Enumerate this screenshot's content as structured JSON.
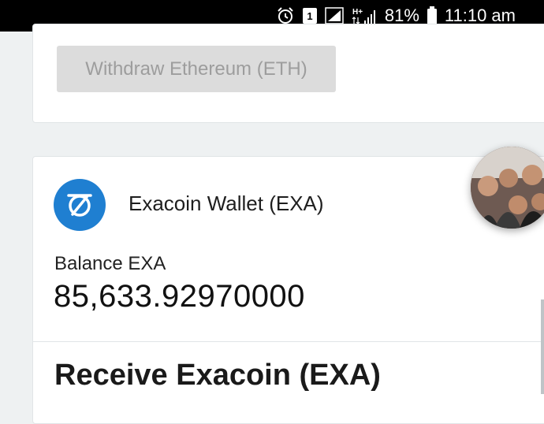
{
  "status_bar": {
    "sim_badge": "1",
    "network_type": "H+",
    "battery_percent": "81%",
    "time": "11:10 am",
    "icons": [
      "alarm-icon",
      "sim-icon",
      "signal-icon",
      "network-icon",
      "battery-icon"
    ]
  },
  "eth_card": {
    "withdraw_label": "Withdraw Ethereum (ETH)"
  },
  "exa_card": {
    "logo_icon": "exacoin-logo-icon",
    "wallet_title": "Exacoin Wallet (EXA)",
    "balance_label": "Balance EXA",
    "balance_value": "85,633.92970000",
    "receive_heading": "Receive Exacoin (EXA)"
  },
  "colors": {
    "accent": "#1f7fd1",
    "page_bg": "#eef1f2",
    "disabled_button": "#dcdcdc"
  }
}
